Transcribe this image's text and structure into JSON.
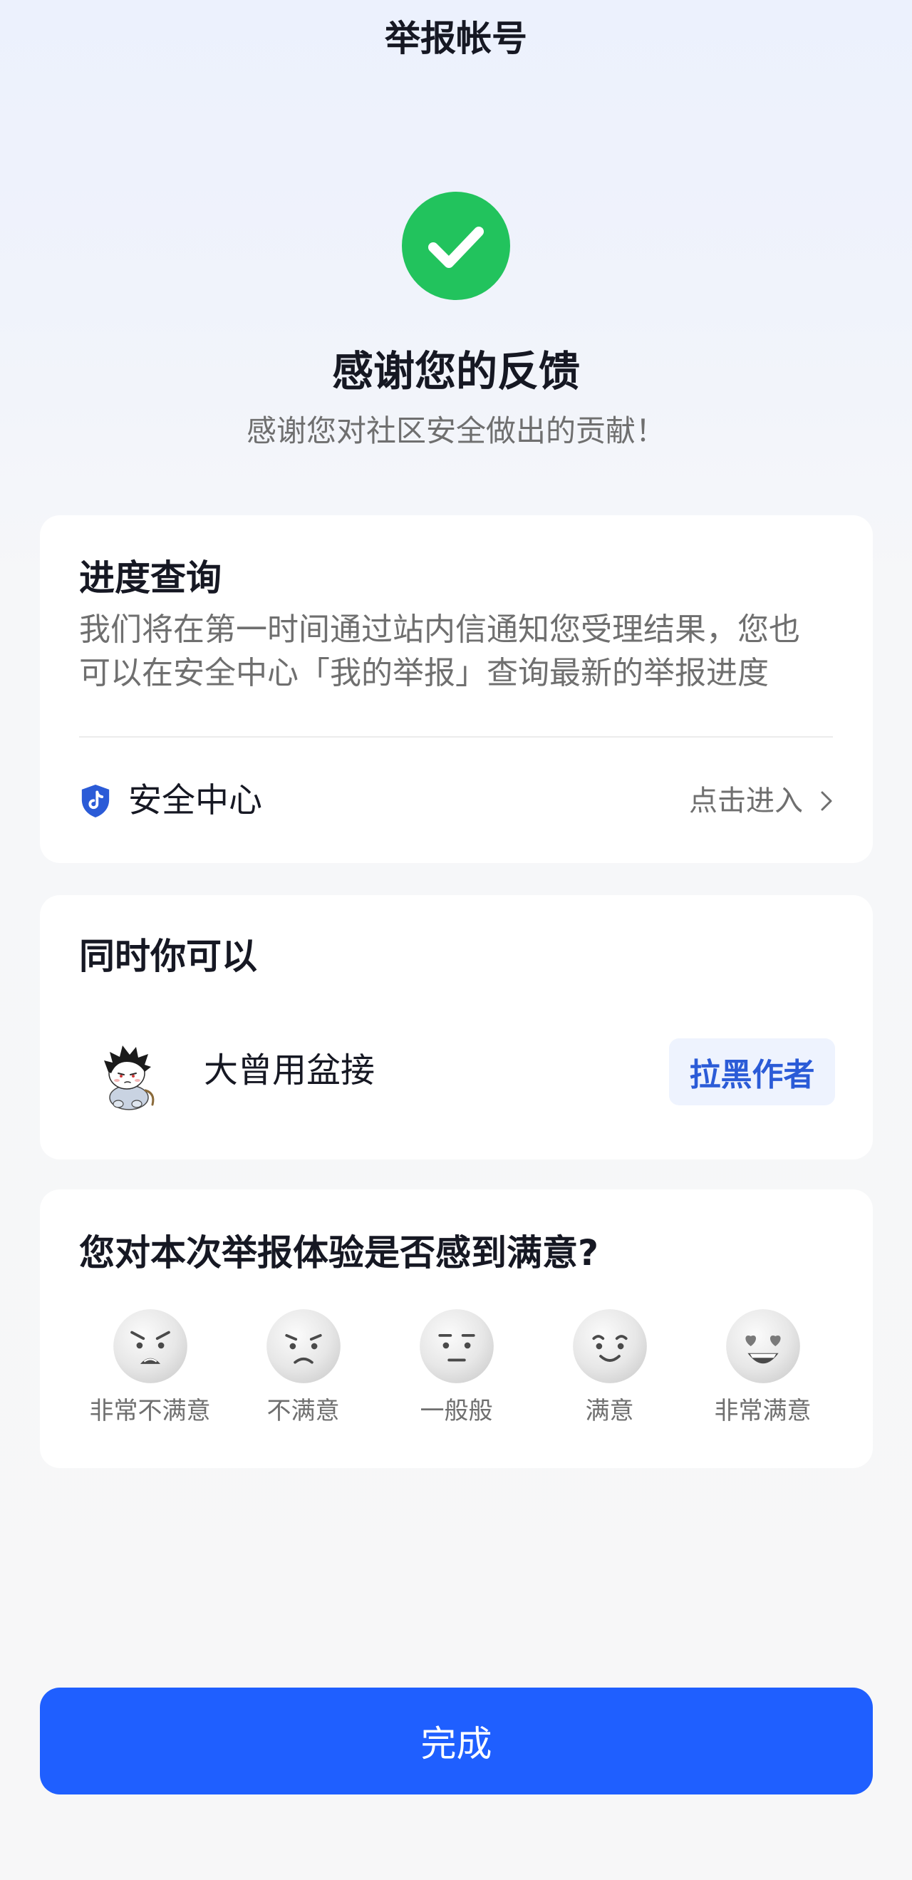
{
  "header": {
    "title": "举报帐号"
  },
  "result": {
    "icon": "check-circle-icon",
    "title": "感谢您的反馈",
    "subtitle": "感谢您对社区安全做出的贡献！"
  },
  "progress_card": {
    "title": "进度查询",
    "description_lines": [
      "我们将在第一时间通过站内信通知您受理结果，您也",
      "可以在安全中心「我的举报」查询最新的举报进度"
    ],
    "security_center": {
      "icon": "shield-icon",
      "label": "安全中心",
      "action_label": "点击进入",
      "action_icon": "chevron-right-icon"
    }
  },
  "actions_card": {
    "title": "同时你可以",
    "author": {
      "name": "大曾用盆接",
      "block_label": "拉黑作者"
    }
  },
  "satisfaction_card": {
    "question": "您对本次举报体验是否感到满意?",
    "options": [
      {
        "icon": "very-dissatisfied-face-icon",
        "label": "非常不满意"
      },
      {
        "icon": "dissatisfied-face-icon",
        "label": "不满意"
      },
      {
        "icon": "neutral-face-icon",
        "label": "一般般"
      },
      {
        "icon": "satisfied-face-icon",
        "label": "满意"
      },
      {
        "icon": "very-satisfied-face-icon",
        "label": "非常满意"
      }
    ]
  },
  "footer": {
    "done_label": "完成"
  },
  "colors": {
    "success": "#22c35d",
    "primary": "#1f5fff",
    "link_blue": "#2b5bd7",
    "block_button_bg": "#eef3fe",
    "page_bg": "#f6f7f9",
    "card_bg": "#ffffff",
    "primary_text": "#161823",
    "secondary_text": "#6f6f6f"
  }
}
